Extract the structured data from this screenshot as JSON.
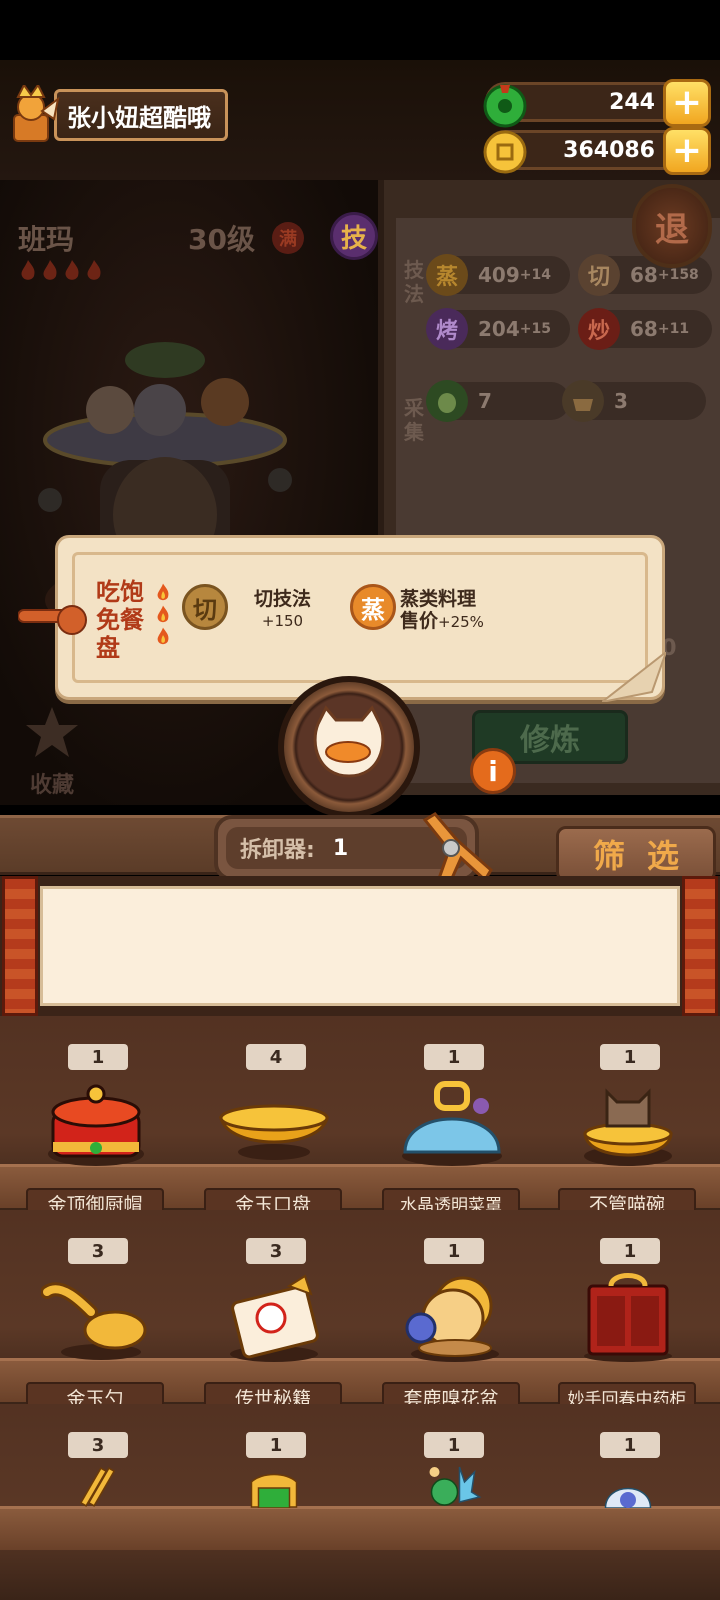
{
  "player": {
    "name": "张小妞超酷哦"
  },
  "resources": {
    "jade": "244",
    "coins": "364086"
  },
  "character": {
    "name": "班玛",
    "level": "30级",
    "maxed": "满",
    "skill_button": "技",
    "favorite_label": "收藏"
  },
  "stats": {
    "technique_label": "技法",
    "gather_label": "采集",
    "steam": {
      "icon": "蒸",
      "value": "409",
      "bonus": "+14"
    },
    "cut": {
      "icon": "切",
      "value": "68",
      "bonus": "+158"
    },
    "roast": {
      "icon": "烤",
      "value": "204",
      "bonus": "+15"
    },
    "fry": {
      "icon": "炒",
      "value": "68",
      "bonus": "+11"
    },
    "veg": {
      "value": "7"
    },
    "grain": {
      "value": "3"
    },
    "hidden_value": "30"
  },
  "exit_button": "退",
  "cultivate_button": "修炼",
  "tooltip": {
    "item_name": "吃饱免餐盘",
    "badge1": "切",
    "effect1_title": "切技法",
    "effect1_value": "+150",
    "badge2": "蒸",
    "effect2_title": "蒸类料理",
    "effect2_sub": "售价",
    "effect2_value": "+25%"
  },
  "disassembler": {
    "label": "拆卸器:",
    "count": "1"
  },
  "filter_button": "筛选",
  "shelves": [
    [
      {
        "count": "1",
        "name": "金顶御厨帽",
        "icon": "chef-hat-icon"
      },
      {
        "count": "4",
        "name": "金玉口盘",
        "icon": "gold-plate-icon"
      },
      {
        "count": "1",
        "name": "水晶透明菜罩",
        "icon": "crystal-cover-icon"
      },
      {
        "count": "1",
        "name": "不管喵碗",
        "icon": "cat-bowl-icon"
      }
    ],
    [
      {
        "count": "3",
        "name": "金玉勺",
        "icon": "gold-spoon-icon"
      },
      {
        "count": "3",
        "name": "传世秘籍",
        "icon": "secret-book-icon"
      },
      {
        "count": "1",
        "name": "套鹿嗅花盆",
        "icon": "flower-pot-icon"
      },
      {
        "count": "1",
        "name": "妙手回春中药柜",
        "icon": "medicine-cabinet-icon"
      }
    ],
    [
      {
        "count": "3",
        "name": "",
        "icon": "chopsticks-icon"
      },
      {
        "count": "1",
        "name": "",
        "icon": "gold-frame-icon"
      },
      {
        "count": "1",
        "name": "",
        "icon": "frog-toy-icon"
      },
      {
        "count": "1",
        "name": "",
        "icon": "blue-plate-icon"
      }
    ]
  ]
}
